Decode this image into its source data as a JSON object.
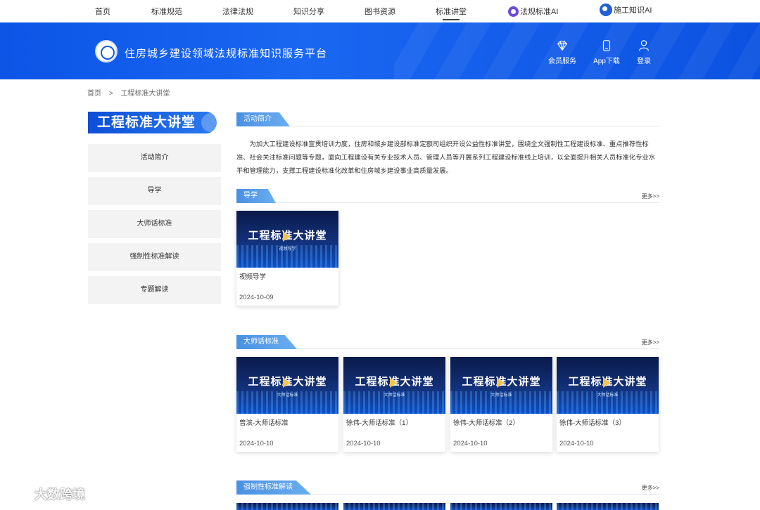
{
  "topnav": {
    "items": [
      "首页",
      "标准规范",
      "法律法规",
      "知识分享",
      "图书资源",
      "标准讲堂"
    ],
    "ai_items": [
      "法规标准AI",
      "施工知识AI"
    ]
  },
  "header": {
    "site_title": "住房城乡建设领域法规标准知识服务平台",
    "buttons": [
      "会员服务",
      "App下载",
      "登录"
    ]
  },
  "breadcrumb": [
    "首页",
    ">",
    "工程标准大讲堂"
  ],
  "sidebar": {
    "title": "工程标准大讲堂",
    "items": [
      "活动简介",
      "导学",
      "大师话标准",
      "强制性标准解读",
      "专题解读"
    ]
  },
  "intro": {
    "tag": "活动简介",
    "text": "为加大工程建设标准宣贯培训力度，住房和城乡建设部标准定额司组织开设公益性标准讲堂，围绕全文强制性工程建设标准、重点推荐性标准、社会关注标准问题等专题，面向工程建设有关专业技术人员、管理人员等开展系列工程建设标准线上培训，以全面提升相关人员标准化专业水平和管理能力，支撑工程建设标准化改革和住房城乡建设事业高质量发展。"
  },
  "sections": [
    {
      "tag": "导学",
      "more": "更多>>",
      "cards": [
        {
          "thumb_title": "工程标准大讲堂",
          "thumb_sub": "视频导学",
          "name": "视频导学",
          "date": "2024-10-09"
        }
      ]
    },
    {
      "tag": "大师话标准",
      "more": "更多>>",
      "cards": [
        {
          "thumb_title": "工程标准大讲堂",
          "thumb_sub": "大师话标准",
          "name": "曾滨-大师话标准",
          "date": "2024-10-10"
        },
        {
          "thumb_title": "工程标准大讲堂",
          "thumb_sub": "大师话标准",
          "name": "徐伟-大师话标准（1）",
          "date": "2024-10-10"
        },
        {
          "thumb_title": "工程标准大讲堂",
          "thumb_sub": "大师话标准",
          "name": "徐伟-大师话标准（2）",
          "date": "2024-10-10"
        },
        {
          "thumb_title": "工程标准大讲堂",
          "thumb_sub": "大师话标准",
          "name": "徐伟-大师话标准（3）",
          "date": "2024-10-10"
        }
      ]
    },
    {
      "tag": "强制性标准解读",
      "more": "更多>>",
      "cards": []
    }
  ],
  "watermark": "大数跨境",
  "colors": {
    "primary": "#1160ea",
    "tag": "#4a90e2"
  }
}
